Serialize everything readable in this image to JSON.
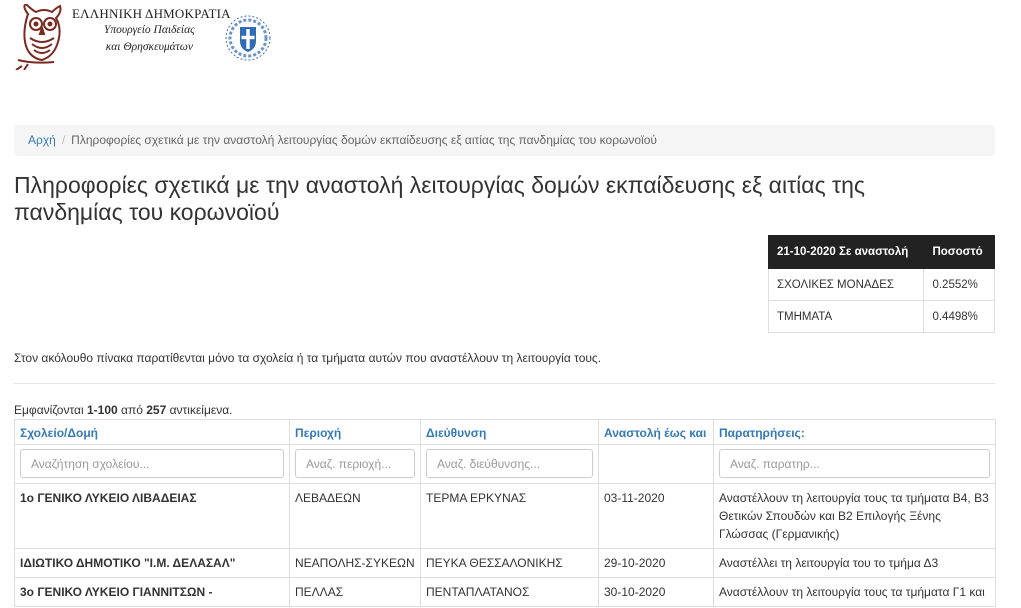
{
  "header": {
    "title": "ΕΛΛΗΝΙΚΗ ΔΗΜΟΚΡΑΤΙΑ",
    "sub1": "Υπουργείο Παιδείας",
    "sub2": "και Θρησκευμάτων",
    "logo_icon": "owl-logo-icon",
    "emblem_icon": "greek-emblem-icon"
  },
  "breadcrumb": {
    "home": "Αρχή",
    "separator": "/",
    "current": "Πληροφορίες σχετικά με την αναστολή λειτουργίας δομών εκπαίδευσης εξ αιτίας της πανδημίας του κορωνοϊού"
  },
  "page_title": "Πληροφορίες σχετικά με την αναστολή λειτουργίας δομών εκπαίδευσης εξ αιτίας της πανδημίας του κορωνοϊού",
  "stats": {
    "col1": "21-10-2020 Σε αναστολή",
    "col2": "Ποσοστό",
    "rows": [
      {
        "label": "ΣΧΟΛΙΚΕΣ ΜΟΝΑΔΕΣ",
        "value": "0.2552%"
      },
      {
        "label": "ΤΜΗΜΑΤΑ",
        "value": "0.4498%"
      }
    ]
  },
  "note": "Στον ακόλουθο πίνακα παρατίθενται μόνο τα σχολεία ή τα τμήματα αυτών που αναστέλλουν τη λειτουργία τους.",
  "summary": {
    "prefix": "Εμφανίζονται ",
    "range": "1-100",
    "middle": " από ",
    "total": "257",
    "suffix": " αντικείμενα."
  },
  "grid": {
    "headers": [
      "Σχολείο/Δομή",
      "Περιοχή",
      "Διεύθυνση",
      "Αναστολή έως και",
      "Παρατηρήσεις:"
    ],
    "placeholders": [
      "Αναζήτηση σχολείου...",
      "Αναζ. περιοχή...",
      "Αναζ. διεύθυνσης...",
      "Αναζ. παρατηρ..."
    ],
    "rows": [
      {
        "school": "1ο ΓΕΝΙΚΟ ΛΥΚΕΙΟ ΛΙΒΑΔΕΙΑΣ",
        "area": "ΛΕΒΑΔΕΩΝ",
        "address": "ΤΕΡΜΑ ΕΡΚΥΝΑΣ",
        "until": "03-11-2020",
        "notes": "Αναστέλλουν τη λειτουργία τους τα τμήματα Β4, Β3 Θετικών Σπουδών και Β2 Επιλογής Ξένης Γλώσσας (Γερμανικής)"
      },
      {
        "school": "ΙΔΙΩΤΙΚΟ ΔΗΜΟΤΙΚΟ \"Ι.Μ. ΔΕΛΑΣΑΛ\"",
        "area": "ΝΕΑΠΟΛΗΣ-ΣΥΚΕΩΝ",
        "address": "ΠΕΥΚΑ ΘΕΣΣΑΛΟΝΙΚΗΣ",
        "until": "29-10-2020",
        "notes": "Αναστέλλει τη λειτουργία του το τμήμα Δ3"
      },
      {
        "school": "3ο ΓΕΝΙΚΟ ΛΥΚΕΙΟ ΓΙΑΝΝΙΤΣΩΝ -",
        "area": "ΠΕΛΛΑΣ",
        "address": "ΠΕΝΤΑΠΛΑΤΑΝΟΣ",
        "until": "30-10-2020",
        "notes": "Αναστέλλουν τη λειτουργία τους τα τμήματα Γ1 και"
      }
    ]
  }
}
